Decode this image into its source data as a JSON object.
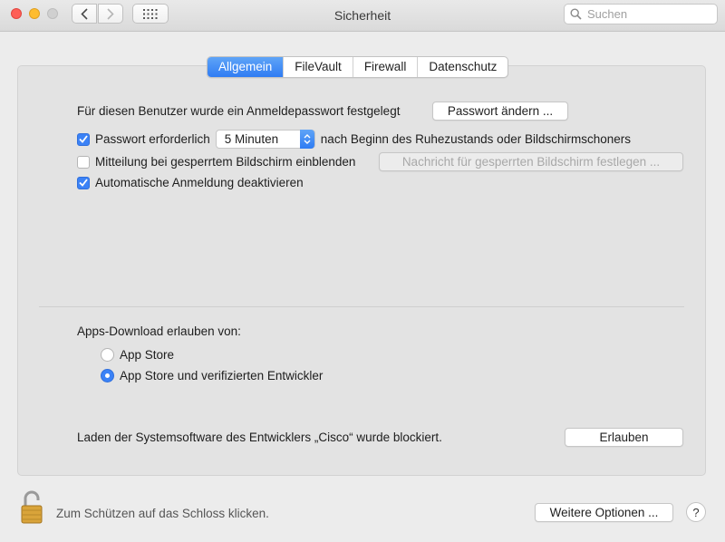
{
  "window": {
    "title": "Sicherheit"
  },
  "toolbar": {
    "back_icon": "chevron-left-icon",
    "forward_icon": "chevron-right-icon",
    "grid_icon": "grid-icon",
    "search_placeholder": "Suchen"
  },
  "tabs": [
    {
      "label": "Allgemein",
      "active": true
    },
    {
      "label": "FileVault",
      "active": false
    },
    {
      "label": "Firewall",
      "active": false
    },
    {
      "label": "Datenschutz",
      "active": false
    }
  ],
  "general": {
    "password_set_text": "Für diesen Benutzer wurde ein Anmeldepasswort festgelegt",
    "change_password_button": "Passwort ändern ...",
    "require_password": {
      "label": "Passwort erforderlich",
      "checked": true
    },
    "delay_select": {
      "value": "5 Minuten"
    },
    "after_text": "nach Beginn des Ruhezustands oder Bildschirmschoners",
    "lock_message": {
      "label": "Mitteilung bei gesperrtem Bildschirm einblenden",
      "checked": false
    },
    "lock_message_button": "Nachricht für gesperrten Bildschirm festlegen ...",
    "disable_autologin": {
      "label": "Automatische Anmeldung deaktivieren",
      "checked": true
    }
  },
  "downloads": {
    "heading": "Apps-Download erlauben von:",
    "options": [
      {
        "label": "App Store",
        "selected": false
      },
      {
        "label": "App Store und verifizierten Entwickler",
        "selected": true
      }
    ]
  },
  "blocked": {
    "text": "Laden der Systemsoftware des Entwicklers „Cisco“ wurde blockiert.",
    "allow_button": "Erlauben"
  },
  "footer": {
    "lock_text": "Zum Schützen auf das Schloss klicken.",
    "more_options_button": "Weitere Optionen ...",
    "help_label": "?"
  },
  "colors": {
    "accent": "#3b82f6"
  }
}
